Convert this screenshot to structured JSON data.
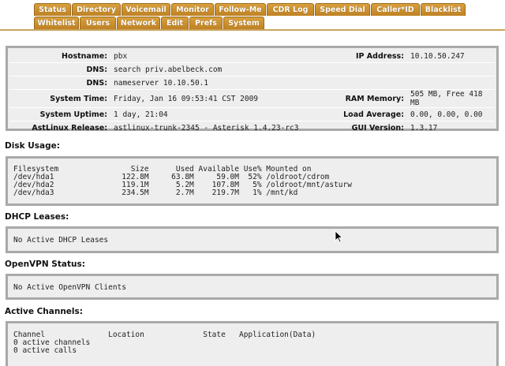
{
  "tabs_row1": [
    "Status",
    "Directory",
    "Voicemail",
    "Monitor",
    "Follow-Me",
    "CDR Log",
    "Speed Dial",
    "Caller*ID",
    "Blacklist"
  ],
  "tabs_row2": [
    "Whitelist",
    "Users",
    "Network",
    "Edit",
    "Prefs",
    "System"
  ],
  "system_info": {
    "hostname_label": "Hostname:",
    "hostname": "pbx",
    "ip_label": "IP Address:",
    "ip": "10.10.50.247",
    "dns_label": "DNS:",
    "dns1": "search priv.abelbeck.com",
    "dns2": "nameserver 10.10.50.1",
    "time_label": "System Time:",
    "time": "Friday, Jan 16 09:53:41 CST 2009",
    "ram_label": "RAM Memory:",
    "ram": "505 MB, Free 418 MB",
    "uptime_label": "System Uptime:",
    "uptime": "1 day, 21:04",
    "load_label": "Load Average:",
    "load": "0.00, 0.00, 0.00",
    "release_label": "AstLinux Release:",
    "release": "astlinux-trunk-2345 - Asterisk 1.4.23-rc3",
    "gui_label": "GUI Version:",
    "gui": "1.3.17"
  },
  "disk": {
    "title": "Disk Usage:",
    "text": "Filesystem                Size      Used Available Use% Mounted on\n/dev/hda1               122.8M     63.8M     59.0M  52% /oldroot/cdrom\n/dev/hda2               119.1M      5.2M    107.8M   5% /oldroot/mnt/asturw\n/dev/hda3               234.5M      2.7M    219.7M   1% /mnt/kd"
  },
  "dhcp": {
    "title": "DHCP Leases:",
    "text": "No Active DHCP Leases"
  },
  "openvpn": {
    "title": "OpenVPN Status:",
    "text": "No Active OpenVPN Clients"
  },
  "channels": {
    "title": "Active Channels:",
    "text": "Channel              Location             State   Application(Data)\n0 active channels\n0 active calls"
  }
}
